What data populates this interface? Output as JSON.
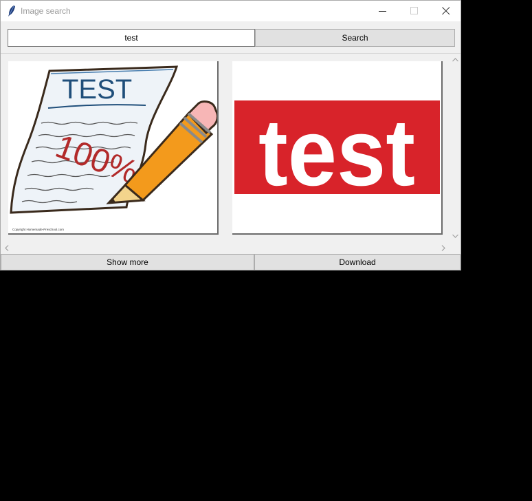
{
  "window": {
    "title": "Image search"
  },
  "titlebar_icons": {
    "app": "feather-icon",
    "minimize": "minimize-icon",
    "maximize": "maximize-icon",
    "close": "close-icon"
  },
  "search": {
    "value": "test",
    "button_label": "Search"
  },
  "results": [
    {
      "kind": "test-paper-with-pencil-clipart",
      "heading": "TEST",
      "score": "100%",
      "copyright": "Copyright Homemade-Preschool.com"
    },
    {
      "kind": "red-banner-logo",
      "logo_text": "test",
      "banner_color": "#d8232a"
    }
  ],
  "footer": {
    "show_more_label": "Show more",
    "download_label": "Download"
  }
}
